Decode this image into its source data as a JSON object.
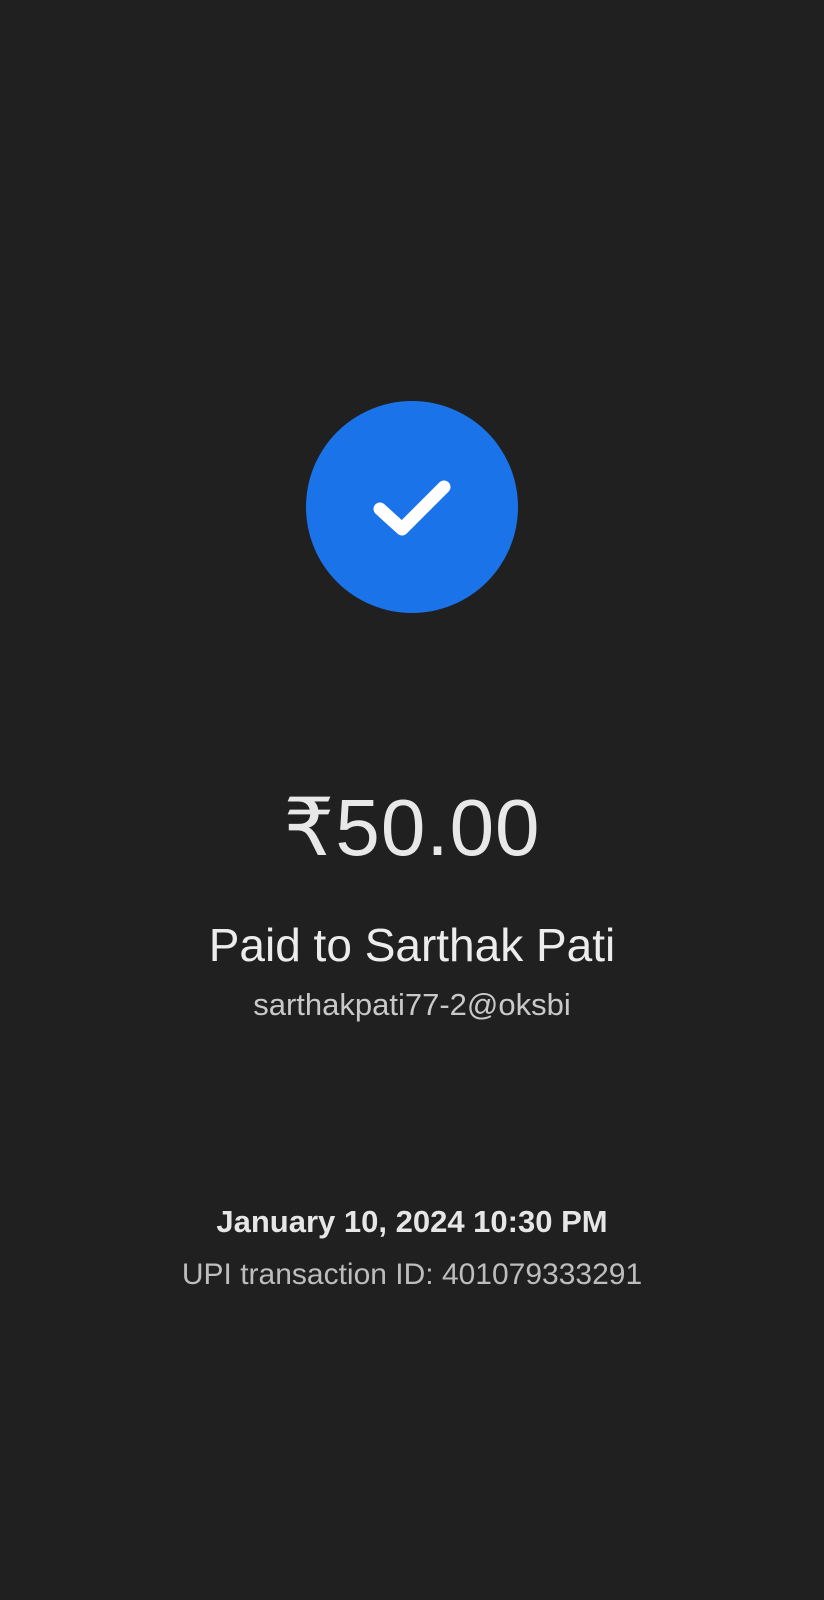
{
  "payment": {
    "status_icon": "check-icon",
    "accent_color": "#1a73e8",
    "amount": "₹50.00",
    "paid_to": "Paid to Sarthak Pati",
    "upi_id": "sarthakpati77-2@oksbi",
    "datetime": "January 10, 2024 10:30 PM",
    "transaction_id": "UPI transaction ID: 401079333291"
  }
}
